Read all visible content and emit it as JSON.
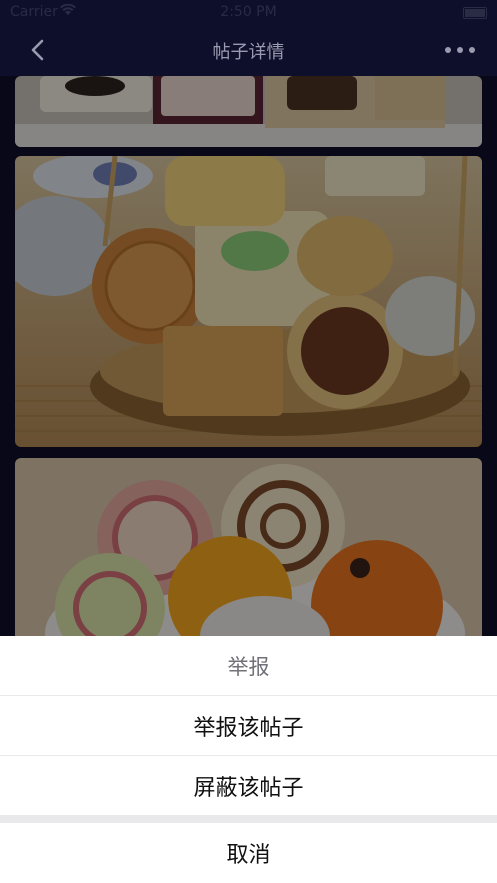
{
  "status_bar": {
    "carrier": "Carrier",
    "time": "2:50 PM"
  },
  "nav": {
    "title": "帖子详情",
    "back_icon": "chevron-left-icon",
    "more_icon": "more-horizontal-icon"
  },
  "feed": {
    "images": [
      {
        "icon": "pastry-photo"
      },
      {
        "icon": "mooncake-basket-photo"
      },
      {
        "icon": "colorful-pastries-photo"
      }
    ]
  },
  "action_sheet": {
    "title": "举报",
    "option_report": "举报该帖子",
    "option_block": "屏蔽该帖子",
    "cancel": "取消"
  },
  "colors": {
    "background": "#0e0f2a",
    "sheet_background": "#ffffff",
    "sheet_separator": "#e9e9ec"
  }
}
